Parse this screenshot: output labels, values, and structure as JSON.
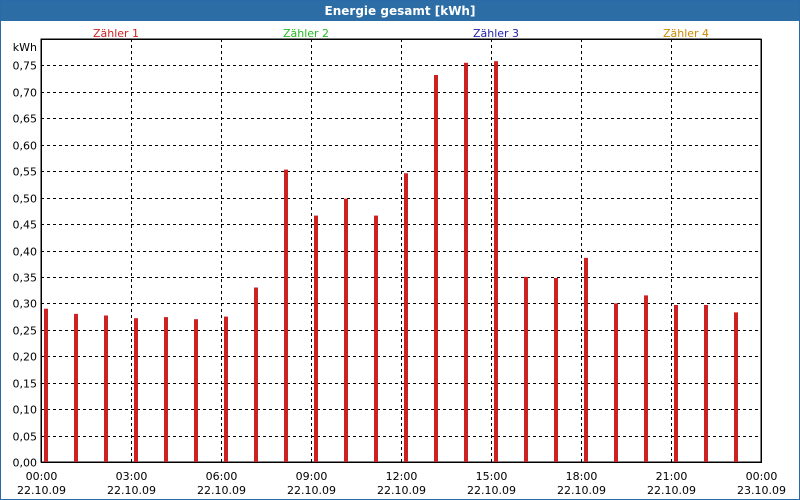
{
  "window": {
    "title": "Energie gesamt [kWh]"
  },
  "legend": [
    {
      "name": "Zähler 1",
      "color": "#cc2222"
    },
    {
      "name": "Zähler 2",
      "color": "#22bb22"
    },
    {
      "name": "Zähler 3",
      "color": "#2222aa"
    },
    {
      "name": "Zähler 4",
      "color": "#cc8800"
    }
  ],
  "chart_data": {
    "type": "bar",
    "ylabel": "kWh",
    "ylim": [
      0,
      0.8
    ],
    "yticks": [
      0,
      0.05,
      0.1,
      0.15,
      0.2,
      0.25,
      0.3,
      0.35,
      0.4,
      0.45,
      0.5,
      0.55,
      0.6,
      0.65,
      0.7,
      0.75
    ],
    "ytick_labels": [
      "0,00",
      "0,05",
      "0,10",
      "0,15",
      "0,20",
      "0,25",
      "0,30",
      "0,35",
      "0,40",
      "0,45",
      "0,50",
      "0,55",
      "0,60",
      "0,65",
      "0,70",
      "0,75"
    ],
    "xlim_hours": [
      0,
      24
    ],
    "x_ticks": [
      {
        "hour": 0,
        "time": "00:00",
        "date": "22.10.09"
      },
      {
        "hour": 3,
        "time": "03:00",
        "date": "22.10.09"
      },
      {
        "hour": 6,
        "time": "06:00",
        "date": "22.10.09"
      },
      {
        "hour": 9,
        "time": "09:00",
        "date": "22.10.09"
      },
      {
        "hour": 12,
        "time": "12:00",
        "date": "22.10.09"
      },
      {
        "hour": 15,
        "time": "15:00",
        "date": "22.10.09"
      },
      {
        "hour": 18,
        "time": "18:00",
        "date": "22.10.09"
      },
      {
        "hour": 21,
        "time": "21:00",
        "date": "22.10.09"
      },
      {
        "hour": 24,
        "time": "00:00",
        "date": "23.10.09"
      }
    ],
    "grid": true,
    "series": [
      {
        "name": "Zähler 1",
        "color": "#cc2222",
        "hours": [
          0,
          1,
          2,
          3,
          4,
          5,
          6,
          7,
          8,
          9,
          10,
          11,
          12,
          13,
          14,
          15,
          16,
          17,
          18,
          19,
          20,
          21,
          22,
          23
        ],
        "values": [
          0.29,
          0.28,
          0.277,
          0.272,
          0.274,
          0.27,
          0.275,
          0.33,
          0.553,
          0.466,
          0.498,
          0.466,
          0.546,
          0.732,
          0.755,
          0.758,
          0.35,
          0.348,
          0.386,
          0.3,
          0.315,
          0.297,
          0.297,
          0.283
        ]
      }
    ]
  }
}
